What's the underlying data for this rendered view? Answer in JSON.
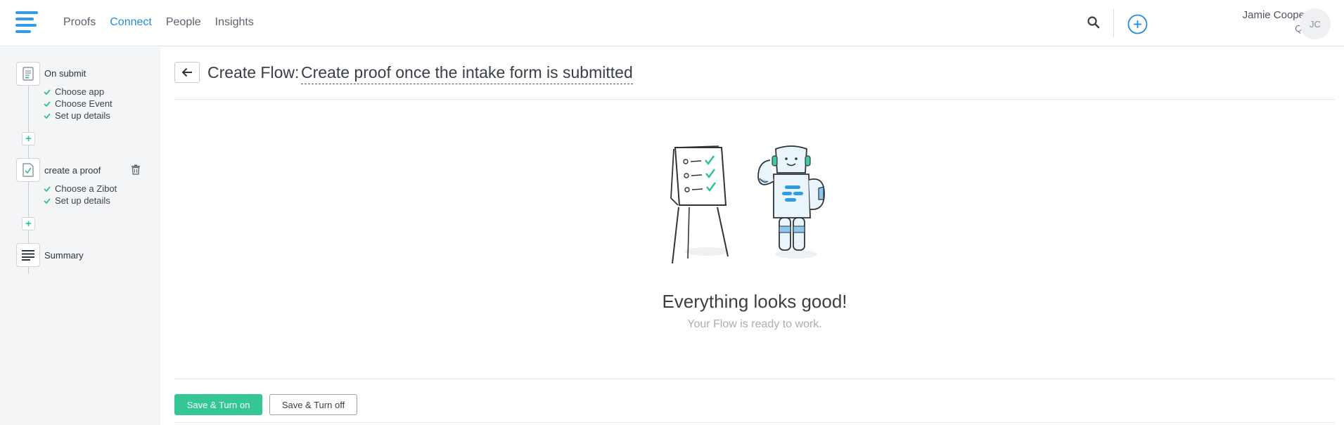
{
  "nav": {
    "logo": "menu-logo-icon",
    "items": [
      {
        "label": "Proofs",
        "active": false
      },
      {
        "label": "Connect",
        "active": true
      },
      {
        "label": "People",
        "active": false
      },
      {
        "label": "Insights",
        "active": false
      }
    ]
  },
  "header": {
    "search_icon": "search-icon",
    "add_icon": "plus-circle-icon",
    "user_name": "Jamie Cooper",
    "user_role": "QA",
    "avatar_initials": "JC"
  },
  "sidebar": {
    "steps": [
      {
        "title": "On submit",
        "icon": "form-document-icon",
        "substeps": [
          "Choose app",
          "Choose Event",
          "Set up details"
        ]
      },
      {
        "title": "create a proof",
        "icon": "proof-document-icon",
        "substeps": [
          "Choose a Zibot",
          "Set up details"
        ],
        "deletable": true
      },
      {
        "title": "Summary",
        "icon": "summary-lines-icon",
        "substeps": []
      }
    ],
    "add_step_label": "+"
  },
  "main": {
    "back_icon": "arrow-left-icon",
    "title_prefix": "Create Flow:",
    "flow_name": "Create proof once the intake form is submitted",
    "success_title": "Everything looks good!",
    "success_subtitle": "Your Flow is ready to work.",
    "buttons": {
      "save_on": "Save & Turn on",
      "save_off": "Save & Turn off"
    }
  },
  "colors": {
    "accent_blue": "#1f8fdc",
    "success_green": "#35c793",
    "sidebar_bg": "#f3f5f7"
  }
}
